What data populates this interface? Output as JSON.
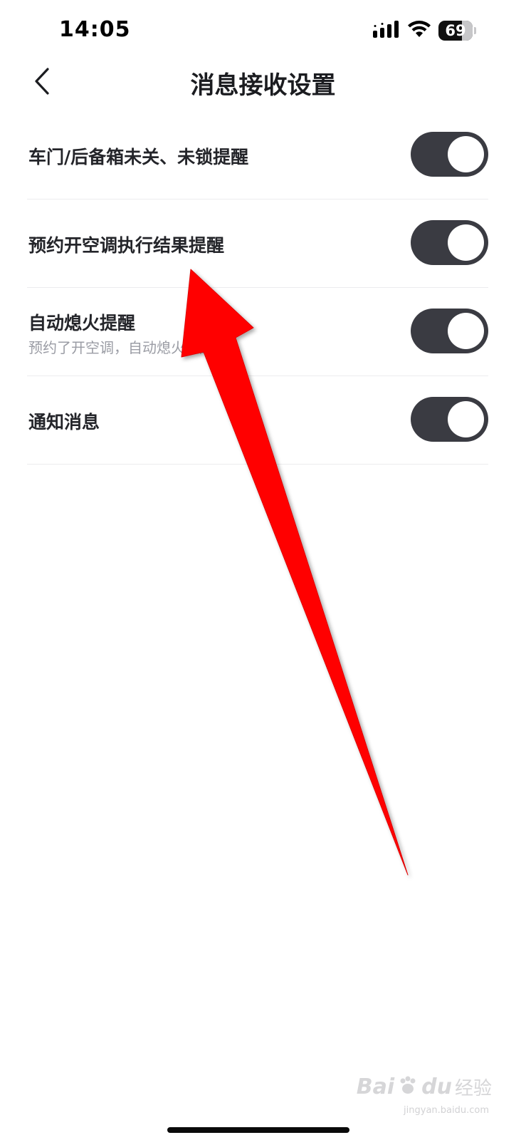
{
  "status_bar": {
    "time": "14:05",
    "battery": "69",
    "battery_level": 0.69,
    "signal_icon": "cellular-signal-icon",
    "wifi_icon": "wifi-icon"
  },
  "header": {
    "title": "消息接收设置",
    "back_icon": "chevron-left-icon"
  },
  "settings": [
    {
      "label": "车门/后备箱未关、未锁提醒",
      "subtitle": "",
      "enabled": true
    },
    {
      "label": "预约开空调执行结果提醒",
      "subtitle": "",
      "enabled": true
    },
    {
      "label": "自动熄火提醒",
      "subtitle": "预约了开空调，自动熄火提醒",
      "enabled": true
    },
    {
      "label": "通知消息",
      "subtitle": "",
      "enabled": true
    }
  ],
  "watermark": {
    "logo": "Bai",
    "logo2": "du",
    "brand": "经验",
    "domain": "jingyan.baidu.com"
  },
  "colors": {
    "toggle_on": "#3a3b42",
    "annotation_arrow": "#ff0000",
    "divider": "#ececee"
  }
}
